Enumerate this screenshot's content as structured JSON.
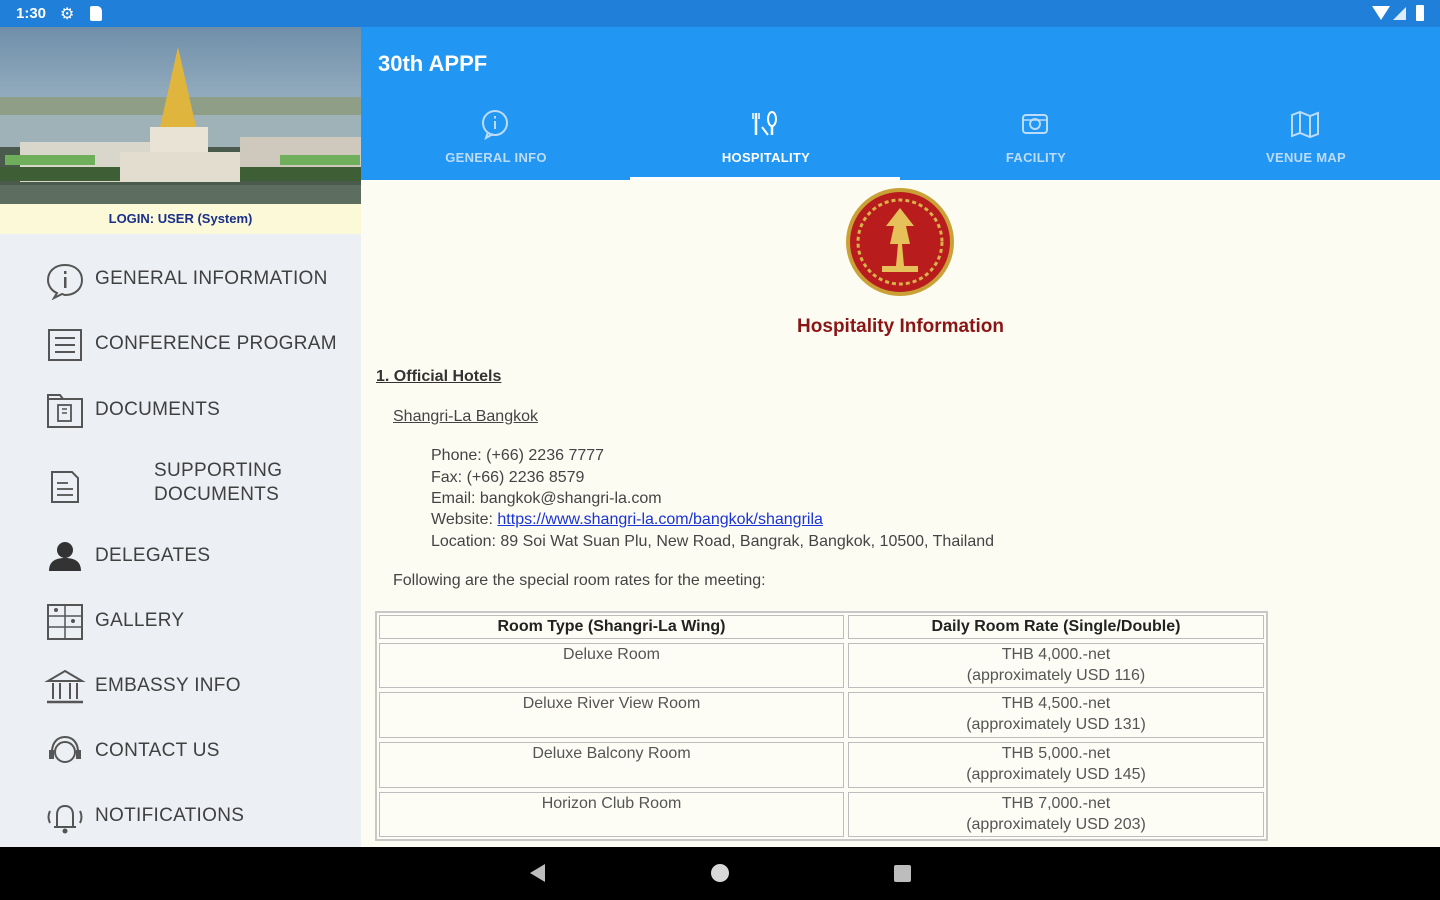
{
  "status_bar": {
    "time": "1:30"
  },
  "sidebar": {
    "login_text": "LOGIN: USER (System)",
    "items": [
      {
        "label": "GENERAL INFORMATION",
        "icon": "info-icon"
      },
      {
        "label": "CONFERENCE PROGRAM",
        "icon": "list-icon"
      },
      {
        "label": "DOCUMENTS",
        "icon": "document-icon"
      },
      {
        "label": "SUPPORTING",
        "label2": "DOCUMENTS",
        "icon": "supporting-document-icon"
      },
      {
        "label": "DELEGATES",
        "icon": "person-icon"
      },
      {
        "label": "GALLERY",
        "icon": "gallery-icon"
      },
      {
        "label": "EMBASSY INFO",
        "icon": "embassy-icon"
      },
      {
        "label": "CONTACT US",
        "icon": "headset-icon"
      },
      {
        "label": "NOTIFICATIONS",
        "icon": "bell-icon"
      }
    ]
  },
  "appbar": {
    "title": "30th APPF",
    "tabs": [
      {
        "label": "GENERAL INFO",
        "icon": "info-icon",
        "active": false
      },
      {
        "label": "HOSPITALITY",
        "icon": "hospitality-icon",
        "active": true
      },
      {
        "label": "FACILITY",
        "icon": "facility-icon",
        "active": false
      },
      {
        "label": "VENUE MAP",
        "icon": "map-icon",
        "active": false
      }
    ]
  },
  "content": {
    "title": "Hospitality Information",
    "section_title": "1. Official Hotels",
    "hotel_name": "Shangri-La Bangkok",
    "phone": "Phone: (+66) 2236 7777",
    "fax": "Fax: (+66) 2236 8579",
    "email": "Email: bangkok@shangri-la.com",
    "website_label": "Website: ",
    "website_url": "https://www.shangri-la.com/bangkok/shangrila",
    "location": "Location: 89 Soi Wat Suan Plu, New Road, Bangrak, Bangkok, 10500, Thailand",
    "rates_intro": "Following are the special room rates for the meeting:",
    "table": {
      "headers": [
        "Room Type (Shangri-La Wing)",
        "Daily Room Rate (Single/Double)"
      ],
      "rows": [
        {
          "room": "Deluxe Room",
          "rate": "THB 4,000.-net",
          "approx": "(approximately USD 116)"
        },
        {
          "room": "Deluxe River View Room",
          "rate": "THB 4,500.-net",
          "approx": "(approximately USD 131)"
        },
        {
          "room": "Deluxe Balcony Room",
          "rate": "THB 5,000.-net",
          "approx": "(approximately USD 145)"
        },
        {
          "room": "Horizon Club Room",
          "rate": "THB 7,000.-net",
          "approx": "(approximately USD 203)"
        }
      ]
    }
  },
  "colors": {
    "primary": "#2196f3",
    "status_bar": "#1f7fd9",
    "title_red": "#8b1515",
    "link": "#1a33d6"
  }
}
